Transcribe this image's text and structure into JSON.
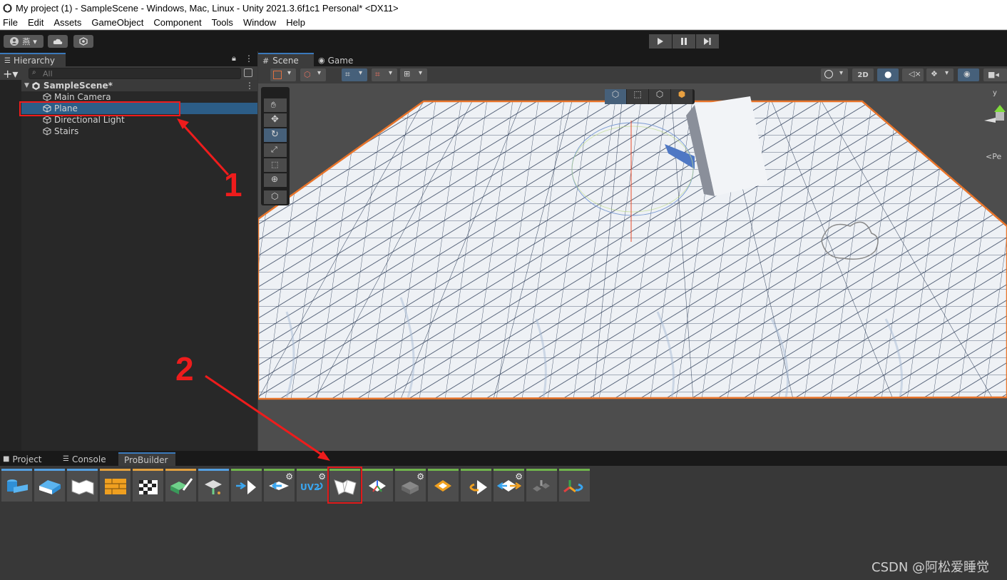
{
  "window": {
    "title": "My project (1) - SampleScene - Windows, Mac, Linux - Unity 2021.3.6f1c1 Personal* <DX11>"
  },
  "menu": [
    "File",
    "Edit",
    "Assets",
    "GameObject",
    "Component",
    "Tools",
    "Window",
    "Help"
  ],
  "toolbar": {
    "account_label": "燕",
    "play_icon": "play-icon",
    "pause_icon": "pause-icon",
    "step_icon": "step-icon"
  },
  "hierarchy": {
    "tab_label": "Hierarchy",
    "search_placeholder": "All",
    "scene_name": "SampleScene*",
    "items": [
      "Main Camera",
      "Plane",
      "Directional Light",
      "Stairs"
    ],
    "selected_item": "Plane"
  },
  "scene_view": {
    "tabs": [
      "Scene",
      "Game"
    ],
    "active_tab": "Scene",
    "mode_2d_label": "2D",
    "gizmo_axis_label": "y",
    "persp_label": "<Pe"
  },
  "bottom_panel": {
    "tabs": [
      "Project",
      "Console",
      "ProBuilder"
    ],
    "active_tab": "ProBuilder",
    "tools": [
      {
        "icon": "shape-tool-icon",
        "color": "#55a0e0",
        "gear": false
      },
      {
        "icon": "poly-shape-icon",
        "color": "#55a0e0",
        "gear": false
      },
      {
        "icon": "smoothing-icon",
        "color": "#55a0e0",
        "gear": false
      },
      {
        "icon": "material-editor-icon",
        "color": "#e0a040",
        "gear": false
      },
      {
        "icon": "uv-editor-icon",
        "color": "#e0a040",
        "gear": false
      },
      {
        "icon": "vertex-colors-icon",
        "color": "#e0a040",
        "gear": false
      },
      {
        "icon": "new-bezier-shape-icon",
        "color": "#55a0e0",
        "gear": false
      },
      {
        "icon": "merge-objects-icon",
        "color": "#6fb34c",
        "gear": false
      },
      {
        "icon": "mirror-objects-icon",
        "color": "#6fb34c",
        "gear": true
      },
      {
        "icon": "generate-uv2-icon",
        "color": "#6fb34c",
        "gear": true
      },
      {
        "icon": "probuilderize-icon",
        "color": "#6fb34c",
        "gear": false
      },
      {
        "icon": "center-pivot-icon",
        "color": "#6fb34c",
        "gear": false
      },
      {
        "icon": "freeze-transform-icon",
        "color": "#6fb34c",
        "gear": true
      },
      {
        "icon": "subdivide-object-icon",
        "color": "#6fb34c",
        "gear": false
      },
      {
        "icon": "flip-normals-icon",
        "color": "#6fb34c",
        "gear": false
      },
      {
        "icon": "conform-normals-icon",
        "color": "#6fb34c",
        "gear": true
      },
      {
        "icon": "export-icon",
        "color": "#6fb34c",
        "gear": false
      },
      {
        "icon": "triangulate-icon",
        "color": "#6fb34c",
        "gear": false
      }
    ],
    "highlighted_tool_index": 10
  },
  "annotations": {
    "label_1": "1",
    "label_2": "2",
    "color": "#ee1c1c"
  },
  "watermark": "CSDN @阿松爱睡觉"
}
